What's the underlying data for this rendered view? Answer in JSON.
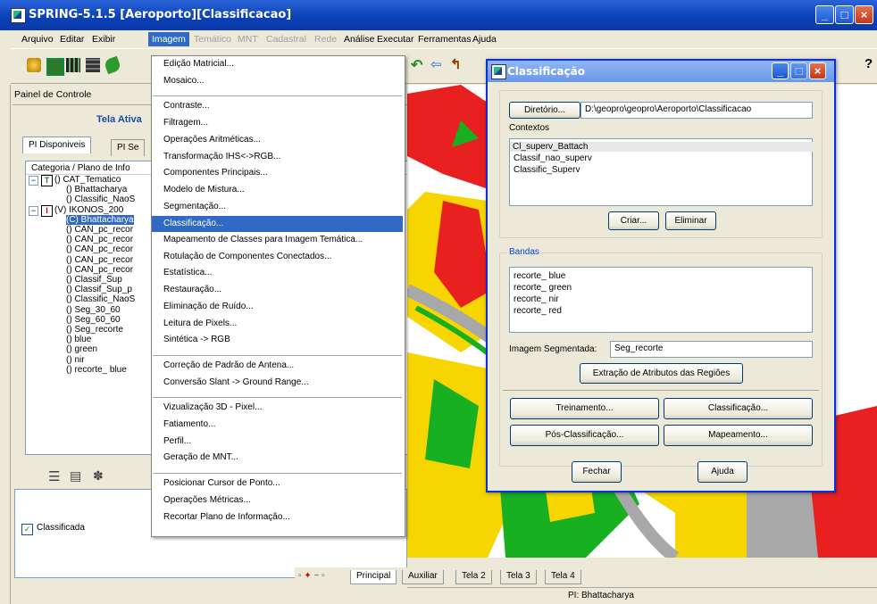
{
  "window": {
    "title": "SPRING-5.1.5 [Aeroporto][Classificacao]",
    "min": "_",
    "max": "□",
    "close": "×"
  },
  "menubar": [
    "Arquivo",
    "Editar",
    "Exibir",
    "Imagem",
    "Temático",
    "MNT",
    "Cadastral",
    "Rede",
    "Análise",
    "Executar",
    "Ferramentas",
    "Ajuda"
  ],
  "left": {
    "panel_title": "Painel de Controle",
    "tela_ativa": "Tela Ativa",
    "tab1": "PI Disponiveis",
    "tab2": "PI Se",
    "tree_header": "Categoria / Plano de Info",
    "tree": [
      {
        "label": "() CAT_Tematico",
        "type": "T"
      },
      {
        "label": "() Bhattacharya"
      },
      {
        "label": "() Classific_NaoS"
      },
      {
        "label": "(V) IKONOS_200",
        "type": "I"
      },
      {
        "label": "(C) Bhattacharya",
        "selected": true
      },
      {
        "label": "() CAN_pc_recor"
      },
      {
        "label": "() CAN_pc_recor"
      },
      {
        "label": "() CAN_pc_recor"
      },
      {
        "label": "() CAN_pc_recor"
      },
      {
        "label": "() CAN_pc_recor"
      },
      {
        "label": "() Classif_Sup"
      },
      {
        "label": "() Classif_Sup_p"
      },
      {
        "label": "() Classific_NaoS"
      },
      {
        "label": "() Seg_30_60"
      },
      {
        "label": "() Seg_60_60"
      },
      {
        "label": "() Seg_recorte"
      },
      {
        "label": "() blue"
      },
      {
        "label": "() green"
      },
      {
        "label": "() nir"
      },
      {
        "label": "() recorte_ blue"
      }
    ],
    "classificada": "Classificada"
  },
  "dropdown": {
    "groups": [
      [
        "Edição Matricial...",
        "Mosaico..."
      ],
      [
        "Contraste...",
        "Filtragem...",
        "Operações Aritméticas...",
        "Transformação IHS<->RGB...",
        "Componentes Principais...",
        "Modelo de Mistura...",
        "Segmentação...",
        "Classificação...",
        "Mapeamento de Classes para Imagem Temática...",
        "Rotulação de Componentes Conectados...",
        "Estatística...",
        "Restauração...",
        "Eliminação de Ruído...",
        "Leitura de Pixels...",
        "Sintética -> RGB"
      ],
      [
        "Correção de Padrão de Antena...",
        "Conversão Slant -> Ground Range..."
      ],
      [
        "Vizualização 3D - Pixel...",
        "Fatiamento...",
        "Perfil...",
        "Geração de MNT..."
      ],
      [
        "Posicionar Cursor de Ponto...",
        "Operações Métricas...",
        "Recortar Plano de Informação..."
      ]
    ],
    "selected": "Classificação..."
  },
  "dialog": {
    "title": "Classificação",
    "diretorio_btn": "Diretório...",
    "diretorio_path": "D:\\geopro\\geopro\\Aeroporto\\Classificacao",
    "contextos_label": "Contextos",
    "contextos": [
      "Cl_superv_Battach",
      "Classif_nao_superv",
      "Classific_Superv"
    ],
    "criar": "Criar...",
    "eliminar": "Eliminar",
    "bandas_label": "Bandas",
    "bandas": [
      "recorte_ blue",
      "recorte_ green",
      "recorte_ nir",
      "recorte_ red"
    ],
    "seg_label": "Imagem Segmentada:",
    "seg_value": "Seg_recorte",
    "extracao": "Extração de Atributos das Regiões",
    "treinamento": "Treinamento...",
    "classificacao": "Classificação...",
    "pos_classificacao": "Pós-Classificação...",
    "mapeamento": "Mapeamento...",
    "fechar": "Fechar",
    "ajuda": "Ajuda"
  },
  "bottom_tabs": [
    "Principal",
    "Auxiliar",
    "Tela 2",
    "Tela 3",
    "Tela 4"
  ],
  "status": "PI: Bhattacharya"
}
